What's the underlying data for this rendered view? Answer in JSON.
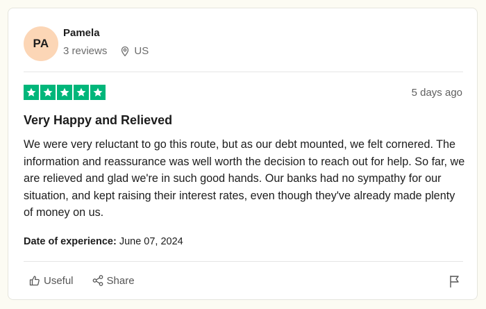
{
  "reviewer": {
    "initials": "PA",
    "name": "Pamela",
    "review_count": "3 reviews",
    "location": "US",
    "avatar_color": "#fcd6b6"
  },
  "review": {
    "rating": 5,
    "rating_max": 5,
    "star_color": "#00b67a",
    "date": "5 days ago",
    "title": "Very Happy and Relieved",
    "body": "We were very reluctant to go this route, but as our debt mounted, we felt cornered. The information and reassurance was well worth the decision to reach out for help. So far, we are relieved and glad we're in such good hands. Our banks had no sympathy for our situation, and kept raising their interest rates, even though they've already made plenty of money on us.",
    "experience_label": "Date of experience:",
    "experience_date": "June 07, 2024"
  },
  "actions": {
    "useful_label": "Useful",
    "share_label": "Share"
  },
  "icons": {
    "location": "location-pin-icon",
    "useful": "thumbs-up-icon",
    "share": "share-icon",
    "report": "flag-icon",
    "star": "star-icon"
  }
}
